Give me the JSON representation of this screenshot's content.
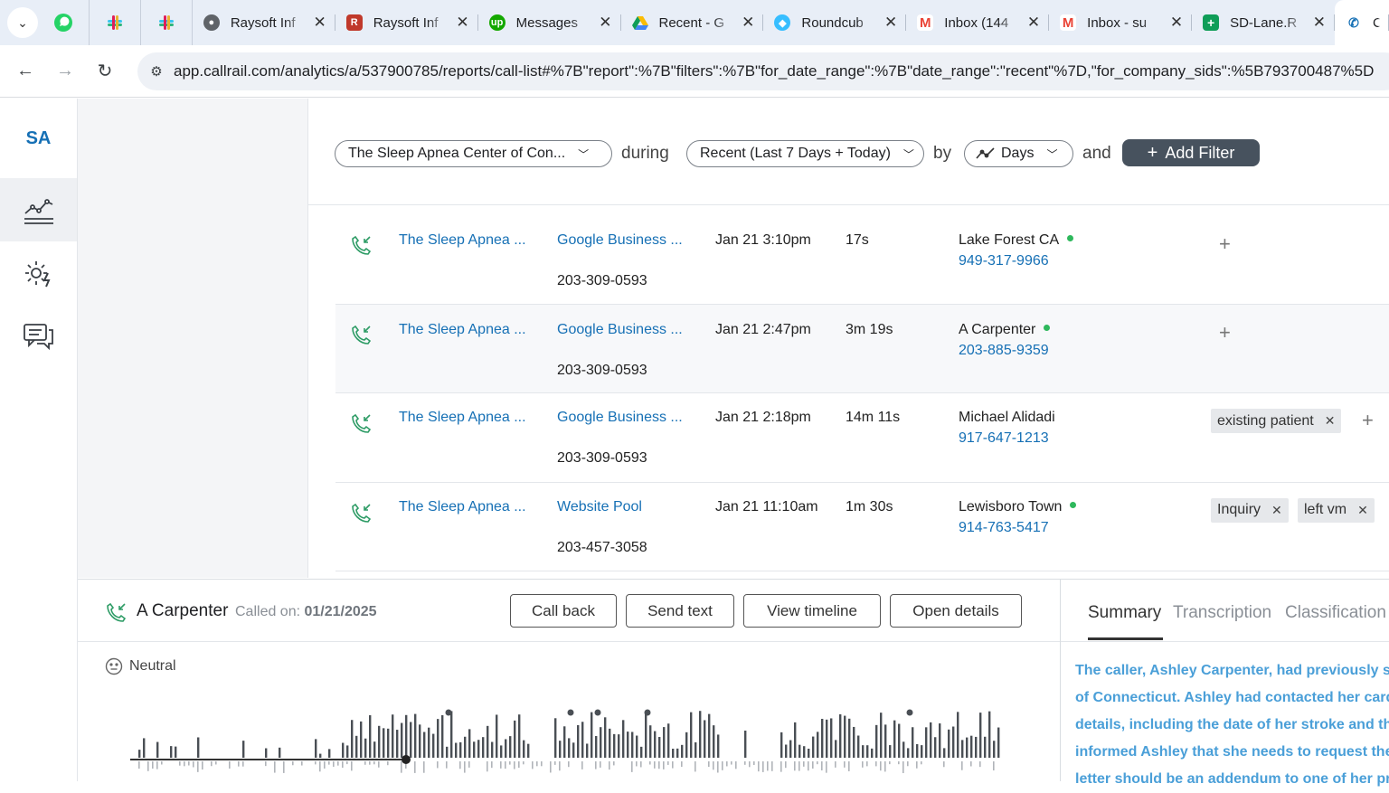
{
  "browser": {
    "tabs": [
      {
        "title": "Raysoft Inf",
        "icon": "globe-icon"
      },
      {
        "title": "Raysoft Inf",
        "icon": "raysoft-icon"
      },
      {
        "title": "Messages",
        "icon": "upwork-icon"
      },
      {
        "title": "Recent - G",
        "icon": "google-drive-icon"
      },
      {
        "title": "Roundcub",
        "icon": "roundcube-icon"
      },
      {
        "title": "Inbox (144",
        "icon": "gmail-icon"
      },
      {
        "title": "Inbox - su",
        "icon": "gmail-icon"
      },
      {
        "title": "SD-Lane.R",
        "icon": "google-sheets-icon"
      },
      {
        "title": "C",
        "icon": "callrail-icon"
      }
    ],
    "url": "app.callrail.com/analytics/a/537900785/reports/call-list#%7B\"report\":%7B\"filters\":%7B\"for_date_range\":%7B\"date_range\":\"recent\"%7D,\"for_company_sids\":%5B793700487%5D"
  },
  "rail": {
    "logo": "SA",
    "items": [
      "analytics-icon",
      "settings-icon",
      "messages-icon"
    ]
  },
  "filters": {
    "company": "The Sleep Apnea Center of Con...",
    "during_label": "during",
    "date_range": "Recent (Last 7 Days + Today)",
    "by_label": "by",
    "granularity": "Days",
    "and_label": "and",
    "add_filter": "Add Filter"
  },
  "calls": [
    {
      "company": "The Sleep Apnea ...",
      "source": "Google Business ...",
      "tracking": "203-309-0593",
      "time": "Jan 21 3:10pm",
      "duration": "17s",
      "caller": "Lake Forest CA",
      "phone": "949-317-9966",
      "online": true,
      "tags": []
    },
    {
      "company": "The Sleep Apnea ...",
      "source": "Google Business ...",
      "tracking": "203-309-0593",
      "time": "Jan 21 2:47pm",
      "duration": "3m 19s",
      "caller": "A Carpenter",
      "phone": "203-885-9359",
      "online": true,
      "tags": []
    },
    {
      "company": "The Sleep Apnea ...",
      "source": "Google Business ...",
      "tracking": "203-309-0593",
      "time": "Jan 21 2:18pm",
      "duration": "14m 11s",
      "caller": "Michael Alidadi",
      "phone": "917-647-1213",
      "online": false,
      "tags": [
        "existing patient"
      ]
    },
    {
      "company": "The Sleep Apnea ...",
      "source": "Website Pool",
      "tracking": "203-457-3058",
      "time": "Jan 21 11:10am",
      "duration": "1m 30s",
      "caller": "Lewisboro Town",
      "phone": "914-763-5417",
      "online": true,
      "tags": [
        "Inquiry",
        "left vm"
      ]
    }
  ],
  "detail": {
    "name": "A Carpenter",
    "called_on_label": "Called on:",
    "called_on_date": "01/21/2025",
    "buttons": {
      "call_back": "Call back",
      "send_text": "Send text",
      "view_timeline": "View timeline",
      "open_details": "Open details"
    },
    "sentiment": "Neutral"
  },
  "side": {
    "tabs": [
      "Summary",
      "Transcription",
      "Classification"
    ],
    "summary_lines": [
      "The caller, Ashley Carpenter, had previously spo",
      "of Connecticut. Ashley had contacted her cardi",
      "details, including the date of her stroke and the",
      "informed Ashley that she needs to request the",
      "letter should be an addendum to one of her pre"
    ]
  },
  "colors": {
    "link": "#1670b5",
    "online": "#2eb85c",
    "button_dark": "#47525e",
    "summary": "#4a9fd8"
  }
}
